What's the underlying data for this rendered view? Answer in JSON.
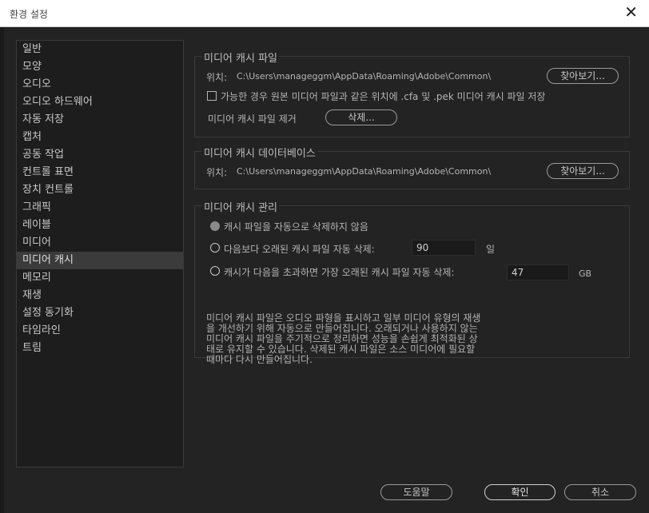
{
  "window": {
    "title": "환경 설정",
    "close_glyph": "✕"
  },
  "sidebar": {
    "items": [
      {
        "label": "일반"
      },
      {
        "label": "모양"
      },
      {
        "label": "오디오"
      },
      {
        "label": "오디오 하드웨어"
      },
      {
        "label": "자동 저장"
      },
      {
        "label": "캡처"
      },
      {
        "label": "공동 작업"
      },
      {
        "label": "컨트롤 표면"
      },
      {
        "label": "장치 컨트롤"
      },
      {
        "label": "그래픽"
      },
      {
        "label": "레이블"
      },
      {
        "label": "미디어"
      },
      {
        "label": "미디어 캐시"
      },
      {
        "label": "메모리"
      },
      {
        "label": "재생"
      },
      {
        "label": "설정 동기화"
      },
      {
        "label": "타임라인"
      },
      {
        "label": "트림"
      }
    ],
    "selected": "미디어 캐시"
  },
  "cache_files": {
    "title": "미디어 캐시 파일",
    "location_label": "위치:",
    "location_path": "C:\\Users\\manageggm\\AppData\\Roaming\\Adobe\\Common\\",
    "browse_label": "찾아보기...",
    "save_next_to_original_label": "가능한 경우 원본 미디어 파일과 같은 위치에 .cfa 및 .pek 미디어 캐시 파일 저장",
    "save_next_to_original_checked": false,
    "remove_label": "미디어 캐시 파일 제거",
    "delete_label": "삭제..."
  },
  "cache_database": {
    "title": "미디어 캐시 데이터베이스",
    "location_label": "위치:",
    "location_path": "C:\\Users\\manageggm\\AppData\\Roaming\\Adobe\\Common\\",
    "browse_label": "찾아보기..."
  },
  "cache_management": {
    "title": "미디어 캐시 관리",
    "option_never_label": "캐시 파일을 자동으로 삭제하지 않음",
    "option_older_label": "다음보다 오래된 캐시 파일 자동 삭제:",
    "older_value": "90",
    "older_unit": "일",
    "option_exceeds_label": "캐시가 다음을 초과하면 가장 오래된 캐시 파일 자동 삭제:",
    "exceeds_value": "47",
    "exceeds_unit": "GB",
    "selected_option": "never",
    "description_lines": [
      "미디어 캐시 파일은 오디오 파형을 표시하고 일부 미디어 유형의 재생",
      "을 개선하기 위해 자동으로 만들어집니다. 오래되거나 사용하지 않는",
      "미디어 캐시 파일을 주기적으로 정리하면 성능을 손쉽게 최적화된 상",
      "태로 유지할 수 있습니다. 삭제된 캐시 파일은 소스 미디어에 필요할",
      "때마다 다시 만들어집니다."
    ]
  },
  "footer": {
    "help_label": "도움말",
    "ok_label": "확인",
    "cancel_label": "취소"
  },
  "colors": {
    "background": "#232323",
    "sidebar_bg": "#1d1d1d",
    "selected_item": "#3b3b3b",
    "text": "#b9b9b9",
    "titlebar": "#ffffff"
  }
}
